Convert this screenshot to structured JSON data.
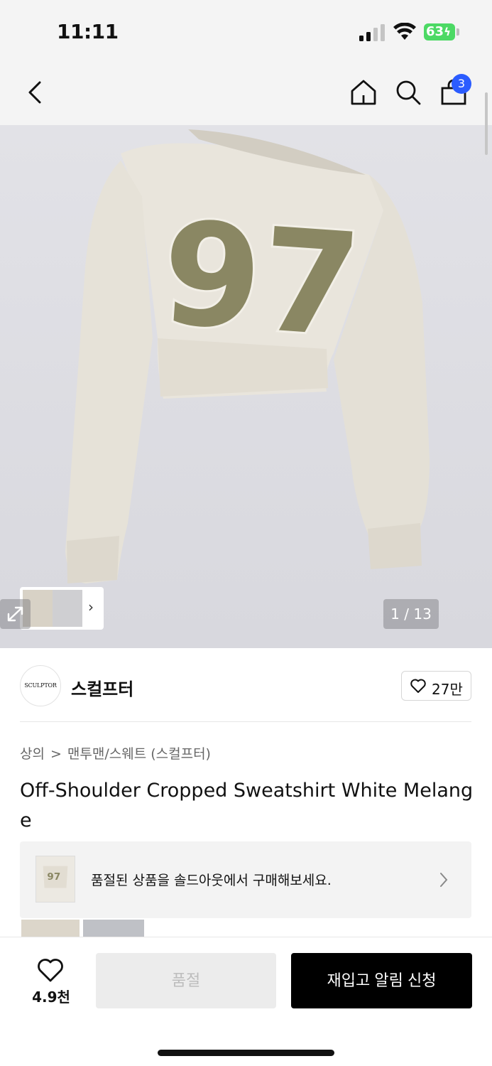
{
  "status": {
    "time": "11:11",
    "battery": "63"
  },
  "nav": {
    "cart_count": "3"
  },
  "gallery": {
    "counter": "1 / 13",
    "graphic_number": "97"
  },
  "brand": {
    "logo_text": "SCULPTOR",
    "name": "스컬프터",
    "likes": "27만"
  },
  "breadcrumb": {
    "level1": "상의",
    "separator": ">",
    "level2": "맨투맨/스웨트 (스컬프터)"
  },
  "product": {
    "title": "Off-Shoulder Cropped Sweatshirt White Melange"
  },
  "banner": {
    "text": "품절된 상품을 솔드아웃에서 구매해보세요."
  },
  "bottom": {
    "wish_count": "4.9천",
    "soldout_label": "품절",
    "restock_label": "재입고 알림 신청"
  },
  "colors": {
    "accent_badge": "#2b5cff",
    "battery": "#4cd964",
    "primary_button": "#000000",
    "disabled_button": "#ececec",
    "sweatshirt": "#e9e5dc",
    "graphic": "#8a8763"
  },
  "icons": {
    "back": "chevron-left-icon",
    "home": "home-icon",
    "search": "search-icon",
    "bag": "shopping-bag-icon",
    "expand": "expand-icon",
    "heart": "heart-icon",
    "arrow": "chevron-right-icon"
  }
}
